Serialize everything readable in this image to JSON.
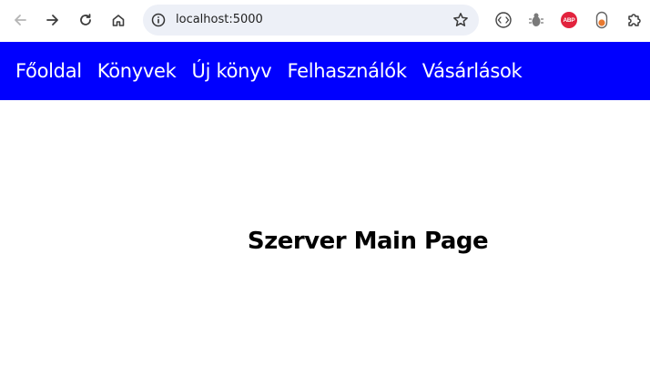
{
  "browser": {
    "url": "localhost:5000",
    "nav_buttons": [
      "back-icon",
      "forward-icon",
      "reload-icon",
      "home-icon"
    ],
    "extensions": [
      "translate-icon",
      "bug-icon",
      "adblock-plus-icon",
      "toggle-extension-icon",
      "extensions-puzzle-icon"
    ],
    "abp_label": "ABP"
  },
  "navbar": {
    "background": "#0000ff",
    "links": [
      "Főoldal",
      "Könyvek",
      "Új könyv",
      "Felhasználók",
      "Vásárlások"
    ]
  },
  "main": {
    "heading": "Szerver Main Page"
  }
}
